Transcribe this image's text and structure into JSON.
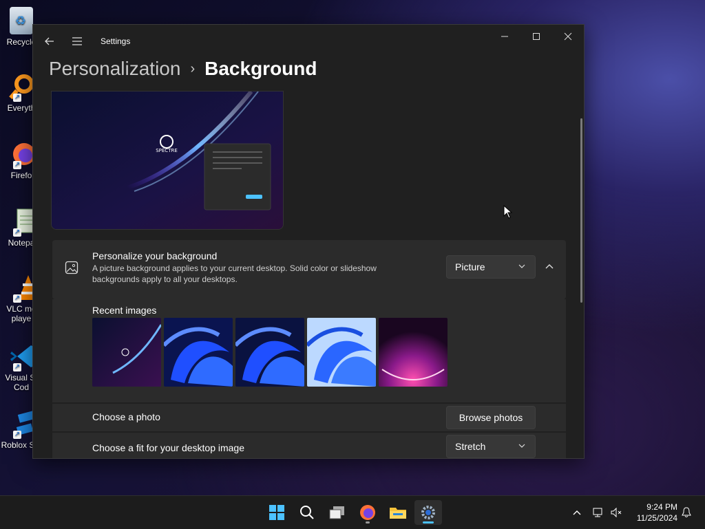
{
  "desktop": {
    "icons": [
      {
        "label": "Recycle",
        "icon": "recycle-bin-icon"
      },
      {
        "label": "Everyth",
        "icon": "everything-search-icon"
      },
      {
        "label": "Firefo",
        "icon": "firefox-icon"
      },
      {
        "label": "Notepa",
        "icon": "notepad-icon"
      },
      {
        "label": "VLC me",
        "label2": "playe",
        "icon": "vlc-icon"
      },
      {
        "label": "Visual St",
        "label2": "Cod",
        "icon": "vscode-icon"
      },
      {
        "label": "Roblox Stu",
        "icon": "roblox-studio-icon"
      }
    ]
  },
  "window": {
    "app_title": "Settings",
    "breadcrumb": {
      "parent": "Personalization",
      "separator": "›",
      "current": "Background"
    },
    "preview": {
      "logo_text": "SPECTRE"
    },
    "personalize": {
      "title": "Personalize your background",
      "description": "A picture background applies to your current desktop. Solid color or slideshow backgrounds apply to all your desktops.",
      "dropdown_value": "Picture"
    },
    "recent_images": {
      "label": "Recent images",
      "thumbnails": [
        "spectre-wallpaper",
        "windows-bloom-blue-dark",
        "windows-bloom-blue-dark-2",
        "windows-bloom-blue-light",
        "purple-glow-arc"
      ]
    },
    "choose_photo": {
      "label": "Choose a photo",
      "button": "Browse photos"
    },
    "choose_fit": {
      "label": "Choose a fit for your desktop image",
      "dropdown_value": "Stretch"
    }
  },
  "taskbar": {
    "apps": [
      "start-icon",
      "search-icon",
      "task-view-icon",
      "firefox-icon",
      "file-explorer-icon",
      "settings-icon"
    ],
    "clock": {
      "time": "9:24 PM",
      "date": "11/25/2024"
    }
  },
  "colors": {
    "accent": "#4cc2ff",
    "window_bg": "#202020",
    "card_bg": "#2b2b2b"
  }
}
